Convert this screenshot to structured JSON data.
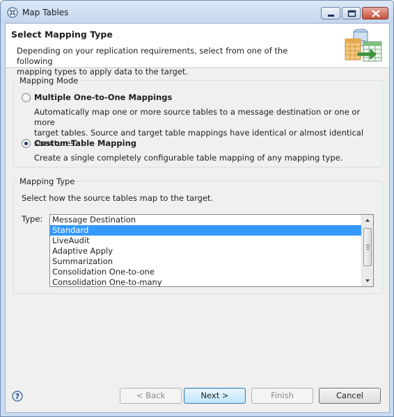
{
  "window": {
    "title": "Map Tables"
  },
  "banner": {
    "title": "Select Mapping Type",
    "description_line1": "Depending on your replication requirements, select from one of the following",
    "description_line2": "mapping types to apply data to the target."
  },
  "mapping_mode": {
    "label": "Mapping Mode",
    "options": [
      {
        "label": "Multiple One-to-One Mappings",
        "checked": false,
        "desc_line1": "Automatically map one or more source tables to a message destination or one or more",
        "desc_line2": "target tables. Source and target table mappings have identical or almost identical structures."
      },
      {
        "label": "Custom Table Mapping",
        "checked": true,
        "desc_line1": "Create a single completely configurable table mapping of any mapping type."
      }
    ]
  },
  "mapping_type": {
    "label": "Mapping Type",
    "instruction": "Select how the source tables map to the target.",
    "type_label": "Type:",
    "selected": "Standard",
    "items": [
      "Message Destination",
      "Standard",
      "LiveAudit",
      "Adaptive Apply",
      "Summarization",
      "Consolidation One-to-one",
      "Consolidation One-to-many"
    ]
  },
  "buttons": {
    "back": "< Back",
    "next": "Next >",
    "finish": "Finish",
    "cancel": "Cancel"
  },
  "colors": {
    "selection": "#3399ff",
    "banner_bg": "#ffffff",
    "dialog_bg": "#f0f0f0"
  },
  "icons": [
    "app-icon",
    "minimize-icon",
    "maximize-icon",
    "close-icon",
    "mapping-tables-icon",
    "help-icon",
    "scroll-up-icon",
    "scroll-down-icon"
  ]
}
